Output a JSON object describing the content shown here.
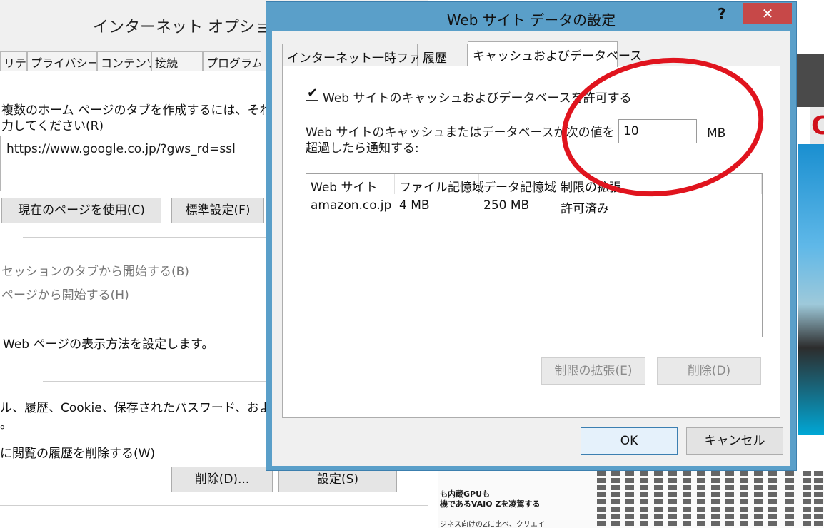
{
  "background_window": {
    "title": "インターネット オプション",
    "tabs": [
      "リティ",
      "プライバシー",
      "コンテンツ",
      "接続",
      "プログラム"
    ],
    "home_text_line1": "複数のホーム ページのタブを作成するには、それぞれ",
    "home_text_line2": "力してください(R)",
    "home_url": "https://www.google.co.jp/?gws_rd=ssl",
    "use_current_label": "現在のページを使用(C)",
    "default_label": "標準設定(F)",
    "start_session_label": "セッションのタブから開始する(B)",
    "start_page_label": "ページから開始する(H)",
    "tabs_desc": "Web ページの表示方法を設定します。",
    "history_desc_line1": "ル、履歴、Cookie、保存されたパスワード、および W",
    "history_desc_line2": "。",
    "delete_on_exit_label": "に閲覧の履歴を削除する(W)",
    "delete_label": "削除(D)...",
    "settings_label": "設定(S)"
  },
  "magazine": {
    "red_letter": "C",
    "headline1": "も内蔵GPUも",
    "headline2": "機であるVAIO Zを凌駕する",
    "body1": "ジネス向けのZに比べ、クリエイ"
  },
  "dialog": {
    "title": "Web サイト データの設定",
    "help_glyph": "?",
    "close_glyph": "✕",
    "tabs": [
      {
        "label": "インターネット一時ファイル"
      },
      {
        "label": "履歴"
      },
      {
        "label": "キャッシュおよびデータベース"
      }
    ],
    "allow_checkbox_label": "Web サイトのキャッシュおよびデータベースを許可する",
    "check_glyph": "✔",
    "notify_line1": "Web サイトのキャッシュまたはデータベースが次の値を",
    "notify_line2": "超過したら通知する:",
    "size_value": "10",
    "size_unit": "MB",
    "columns": [
      "Web サイト",
      "ファイル記憶域",
      "データ記憶域",
      "制限の拡張"
    ],
    "rows": [
      {
        "site": "amazon.co.jp",
        "file_storage": "4 MB",
        "data_storage": "250 MB",
        "extension": "許可済み"
      }
    ],
    "expand_limit_label": "制限の拡張(E)",
    "delete_label": "削除(D)",
    "ok_label": "OK",
    "cancel_label": "キャンセル"
  },
  "colors": {
    "dialog_border": "#5a9fc9",
    "close_button": "#c74848",
    "annotation": "#e0141e"
  }
}
